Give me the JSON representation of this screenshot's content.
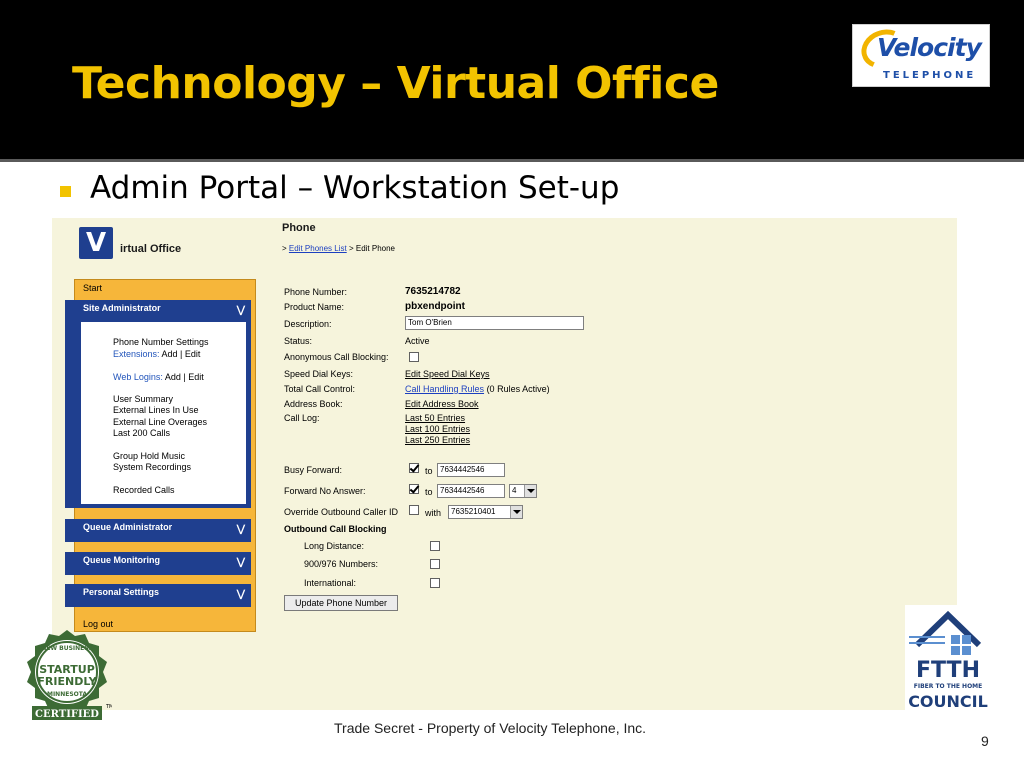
{
  "slide": {
    "title": "Technology – Virtual Office",
    "bullet": "Admin Portal – Workstation Set-up",
    "footer": "Trade Secret - Property of Velocity Telephone, Inc.",
    "page_number": "9"
  },
  "logos": {
    "velocity": {
      "name": "Velocity",
      "sub": "TELEPHONE"
    },
    "startup": {
      "top": "NEW BUSINESS",
      "line1": "STARTUP",
      "line2": "FRIENDLY",
      "state": "MINNESOTA",
      "ribbon": "CERTIFIED",
      "tm": "TM"
    },
    "ftth": {
      "big": "FTTH",
      "line": "FIBER TO THE HOME",
      "word": "COUNCIL"
    }
  },
  "app": {
    "logo_letter": "V",
    "logo_text": "irtual Office"
  },
  "sidebar": {
    "start": "Start",
    "logout": "Log out",
    "site_admin": {
      "title": "Site Administrator",
      "items": [
        {
          "text": "Phone Number Settings"
        },
        {
          "label": "Extensions:",
          "links": "Add | Edit"
        },
        {
          "label": "Web Logins:",
          "links": "Add | Edit"
        },
        {
          "text": "User Summary"
        },
        {
          "text": "External Lines In Use"
        },
        {
          "text": "External Line Overages"
        },
        {
          "text": "Last 200 Calls"
        },
        {
          "text": "Group Hold Music"
        },
        {
          "text": "System Recordings"
        },
        {
          "text": "Recorded Calls"
        }
      ]
    },
    "queue_admin": "Queue Administrator",
    "queue_monitoring": "Queue Monitoring",
    "personal_settings": "Personal Settings"
  },
  "main": {
    "heading": "Phone",
    "breadcrumb": {
      "sep": ">",
      "link": "Edit Phones List",
      "current": "Edit Phone"
    },
    "fields": {
      "phone_number": {
        "label": "Phone Number:",
        "value": "7635214782"
      },
      "product_name": {
        "label": "Product Name:",
        "value": "pbxendpoint"
      },
      "description": {
        "label": "Description:",
        "value": "Tom O'Brien"
      },
      "status": {
        "label": "Status:",
        "value": "Active"
      },
      "anon_block": {
        "label": "Anonymous Call Blocking:",
        "checked": false
      },
      "speed_dial": {
        "label": "Speed Dial Keys:",
        "link": "Edit Speed Dial Keys"
      },
      "total_call": {
        "label": "Total Call Control:",
        "link": "Call Handling Rules",
        "note": "(0 Rules Active)"
      },
      "address_book": {
        "label": "Address Book:",
        "link": "Edit Address Book"
      },
      "call_log": {
        "label": "Call Log:",
        "links": [
          "Last 50 Entries",
          "Last 100 Entries",
          "Last 250 Entries"
        ]
      },
      "busy_forward": {
        "label": "Busy Forward:",
        "checked": true,
        "to": "to",
        "number": "7634442546"
      },
      "forward_no_answer": {
        "label": "Forward No Answer:",
        "checked": true,
        "to": "to",
        "number": "7634442546",
        "rings": "4"
      },
      "override_caller_id": {
        "label": "Override Outbound Caller ID",
        "checked": false,
        "with": "with",
        "number": "7635210401"
      },
      "outbound_blocking": {
        "title": "Outbound Call Blocking",
        "long_distance": {
          "label": "Long Distance:",
          "checked": false
        },
        "premium": {
          "label": "900/976 Numbers:",
          "checked": false
        },
        "international": {
          "label": "International:",
          "checked": false
        }
      }
    },
    "update_button": "Update Phone Number"
  }
}
